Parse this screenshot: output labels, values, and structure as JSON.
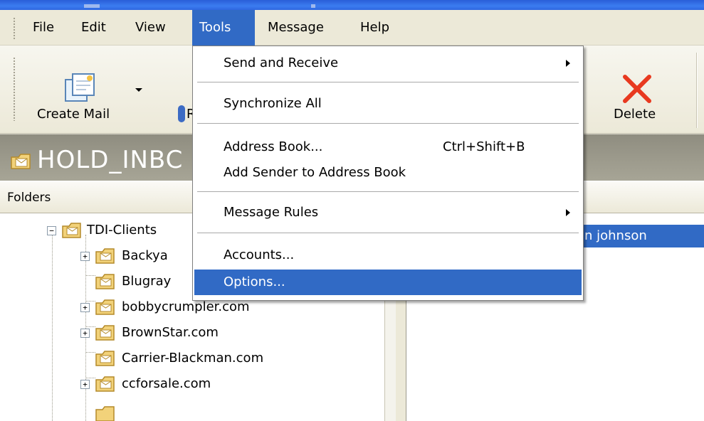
{
  "menubar": {
    "items": [
      {
        "label": "File"
      },
      {
        "label": "Edit"
      },
      {
        "label": "View"
      },
      {
        "label": "Tools",
        "active": true
      },
      {
        "label": "Message"
      },
      {
        "label": "Help"
      }
    ]
  },
  "toolbar": {
    "create_mail_label": "Create Mail",
    "reply_label_fragment": "R",
    "delete_label": "Delete"
  },
  "folder_header": {
    "title": "HOLD_INBC"
  },
  "folders_pane": {
    "title": "Folders",
    "tree": [
      {
        "label": "TDI-Clients",
        "expander": "minus"
      },
      {
        "label": "Backya",
        "expander": "plus"
      },
      {
        "label": "Blugray",
        "expander": "none"
      },
      {
        "label": "bobbycrumpler.com",
        "expander": "plus"
      },
      {
        "label": "BrownStar.com",
        "expander": "plus"
      },
      {
        "label": "Carrier-Blackman.com",
        "expander": "none"
      },
      {
        "label": "ccforsale.com",
        "expander": "plus"
      }
    ]
  },
  "message_list": {
    "selected_row_text": "n johnson"
  },
  "tools_menu": {
    "items": [
      {
        "label": "Send and Receive",
        "submenu": true
      },
      {
        "label": "Synchronize All"
      },
      {
        "label": "Address Book...",
        "shortcut": "Ctrl+Shift+B"
      },
      {
        "label": "Add Sender to Address Book"
      },
      {
        "label": "Message Rules",
        "submenu": true
      },
      {
        "label": "Accounts..."
      },
      {
        "label": "Options...",
        "highlighted": true
      }
    ]
  },
  "colors": {
    "selection": "#316ac5",
    "menubar_bg": "#ece9d8",
    "folder_header_bg": "#a09e90",
    "delete_red": "#e8391f"
  }
}
